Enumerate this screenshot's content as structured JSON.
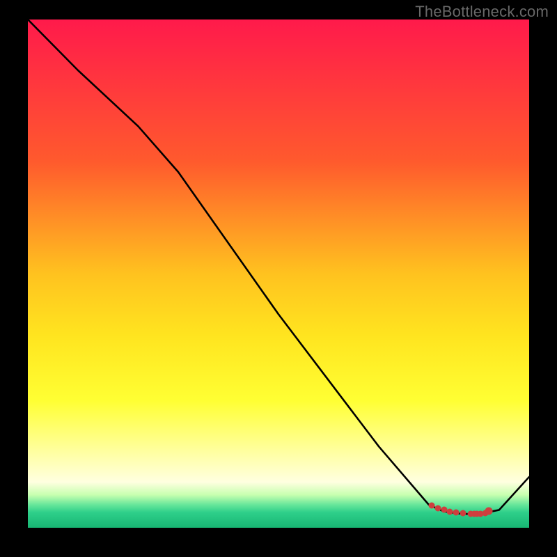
{
  "watermark": "TheBottleneck.com",
  "colors": {
    "bg": "#000000",
    "line": "#000000",
    "marker": "#cf3e3e",
    "watermark": "#686868"
  },
  "chart_data": {
    "type": "line",
    "title": "",
    "xlabel": "",
    "ylabel": "",
    "xlim": [
      0,
      100
    ],
    "ylim": [
      0,
      100
    ],
    "grid": false,
    "gradient_stops": [
      {
        "pos": 0.0,
        "color": "#ff1a4b"
      },
      {
        "pos": 0.28,
        "color": "#ff5a2d"
      },
      {
        "pos": 0.5,
        "color": "#ffc21f"
      },
      {
        "pos": 0.62,
        "color": "#ffe41f"
      },
      {
        "pos": 0.75,
        "color": "#ffff33"
      },
      {
        "pos": 0.85,
        "color": "#ffffa0"
      },
      {
        "pos": 0.91,
        "color": "#ffffe0"
      },
      {
        "pos": 0.935,
        "color": "#c8ffb0"
      },
      {
        "pos": 0.955,
        "color": "#66e69a"
      },
      {
        "pos": 0.97,
        "color": "#2ecf8a"
      },
      {
        "pos": 1.0,
        "color": "#18b673"
      }
    ],
    "series": [
      {
        "name": "bottleneck-curve",
        "x": [
          0,
          10,
          22,
          30,
          40,
          50,
          60,
          70,
          80,
          83,
          86,
          88,
          91,
          94,
          100
        ],
        "y": [
          100,
          90,
          79,
          70,
          56,
          42,
          29,
          16,
          4.5,
          3.2,
          2.8,
          2.7,
          2.9,
          3.5,
          10
        ]
      }
    ],
    "markers": {
      "name": "optimal-range",
      "x": [
        80.5,
        81.8,
        83.0,
        84.2,
        85.4,
        86.8,
        88.3,
        89.0,
        89.6,
        90.3,
        91.2,
        92.0
      ],
      "y": [
        4.4,
        3.9,
        3.5,
        3.2,
        3.0,
        2.85,
        2.75,
        2.72,
        2.73,
        2.78,
        2.9,
        3.25
      ]
    }
  }
}
